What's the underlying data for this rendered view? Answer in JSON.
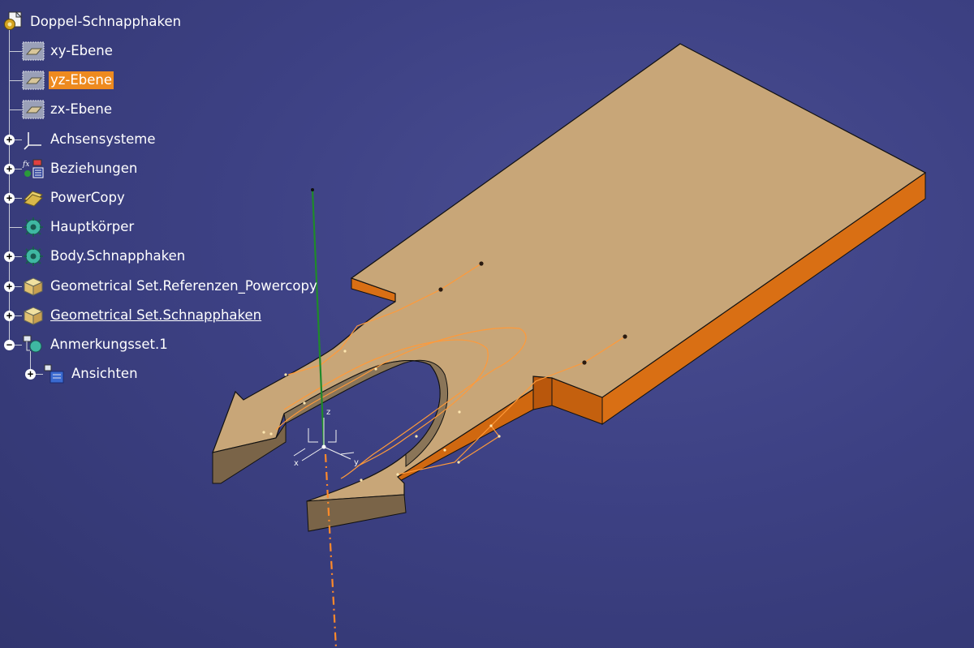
{
  "tree": {
    "root": {
      "label": "Doppel-Schnapphaken",
      "icon": "part-document-icon"
    },
    "items": [
      {
        "label": "xy-Ebene",
        "icon": "plane-icon",
        "expander": "",
        "selected": false,
        "underline": false
      },
      {
        "label": "yz-Ebene",
        "icon": "plane-icon",
        "expander": "",
        "selected": true,
        "underline": false
      },
      {
        "label": "zx-Ebene",
        "icon": "plane-icon",
        "expander": "",
        "selected": false,
        "underline": false
      },
      {
        "label": "Achsensysteme",
        "icon": "axis-system-icon",
        "expander": "+",
        "selected": false,
        "underline": false
      },
      {
        "label": "Beziehungen",
        "icon": "relations-icon",
        "expander": "+",
        "selected": false,
        "underline": false
      },
      {
        "label": "PowerCopy",
        "icon": "powercopy-icon",
        "expander": "+",
        "selected": false,
        "underline": false
      },
      {
        "label": "Hauptkörper",
        "icon": "body-gear-icon",
        "expander": "",
        "selected": false,
        "underline": false
      },
      {
        "label": "Body.Schnapphaken",
        "icon": "body-gear-icon",
        "expander": "+",
        "selected": false,
        "underline": false
      },
      {
        "label": "Geometrical Set.Referenzen_Powercopy",
        "icon": "geometrical-set-icon",
        "expander": "+",
        "selected": false,
        "underline": false
      },
      {
        "label": "Geometrical Set.Schnapphaken",
        "icon": "geometrical-set-icon",
        "expander": "+",
        "selected": false,
        "underline": true
      },
      {
        "label": "Anmerkungsset.1",
        "icon": "annotation-set-icon",
        "expander": "-",
        "selected": false,
        "underline": false
      },
      {
        "label": "Ansichten",
        "icon": "views-icon",
        "expander": "+",
        "selected": false,
        "underline": false,
        "child": true
      }
    ]
  },
  "viewport": {
    "background": "#3d4184",
    "part_top_color": "#c8a678",
    "part_side_color": "#d96f14",
    "slot_wall_color": "#8a7558",
    "sketch_color": "#ff9a3a",
    "axis_labels": {
      "x": "x",
      "y": "y",
      "z": "z"
    }
  }
}
